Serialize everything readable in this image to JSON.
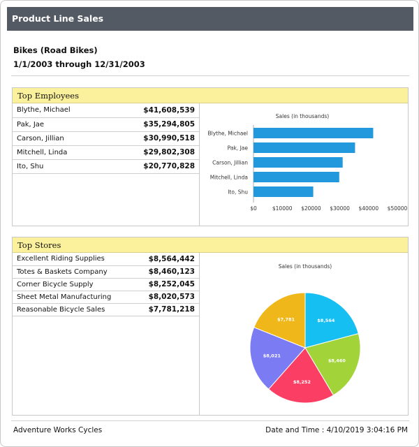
{
  "report": {
    "title": "Product Line Sales",
    "product": "Bikes (Road Bikes)",
    "date_range": "1/1/2003 through 12/31/2003"
  },
  "employees": {
    "header": "Top Employees",
    "rows": [
      {
        "name": "Blythe, Michael",
        "value": "$41,608,539"
      },
      {
        "name": "Pak, Jae",
        "value": "$35,294,805"
      },
      {
        "name": "Carson, Jillian",
        "value": "$30,990,518"
      },
      {
        "name": "Mitchell, Linda",
        "value": "$29,802,308"
      },
      {
        "name": "Ito, Shu",
        "value": "$20,770,828"
      }
    ]
  },
  "stores": {
    "header": "Top Stores",
    "rows": [
      {
        "name": "Excellent Riding Supplies",
        "value": "$8,564,442"
      },
      {
        "name": "Totes & Baskets Company",
        "value": "$8,460,123"
      },
      {
        "name": "Corner Bicycle Supply",
        "value": "$8,252,045"
      },
      {
        "name": "Sheet Metal Manufacturing",
        "value": "$8,020,573"
      },
      {
        "name": "Reasonable Bicycle Sales",
        "value": "$7,781,218"
      }
    ]
  },
  "chart_data": [
    {
      "type": "bar",
      "orientation": "horizontal",
      "title": "Sales (in thousands)",
      "categories": [
        "Blythe, Michael",
        "Pak, Jae",
        "Carson, Jillian",
        "Mitchell, Linda",
        "Ito, Shu"
      ],
      "values": [
        41609,
        35295,
        30991,
        29802,
        20771
      ],
      "xlim": [
        0,
        50000
      ],
      "xticks": [
        "$0",
        "$10000",
        "$20000",
        "$30000",
        "$40000",
        "$50000"
      ],
      "color": "#2299dd",
      "grid": false
    },
    {
      "type": "pie",
      "title": "Sales (in thousands)",
      "labels": [
        "$8,564",
        "$8,460",
        "$8,252",
        "$8,021",
        "$7,781"
      ],
      "values": [
        8564,
        8460,
        8252,
        8021,
        7781
      ],
      "colors": [
        "#16bff2",
        "#a2d43a",
        "#fb3e63",
        "#7b7bf4",
        "#efb71a"
      ]
    }
  ],
  "footer": {
    "company": "Adventure Works Cycles",
    "datetime": "Date and Time : 4/10/2019 3:04:16 PM"
  }
}
